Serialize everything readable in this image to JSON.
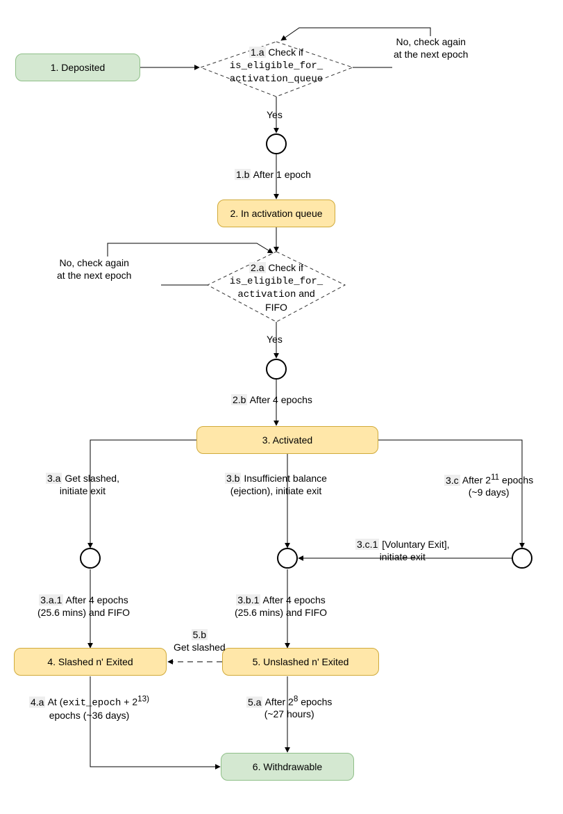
{
  "states": {
    "deposited": "1. Deposited",
    "in_queue": "2. In activation queue",
    "activated": "3. Activated",
    "slashed_exited": "4. Slashed n' Exited",
    "unslashed_exited": "5. Unslashed n' Exited",
    "withdrawable": "6. Withdrawable"
  },
  "steps": {
    "s1a": "1.a",
    "s1b": "1.b",
    "s2a": "2.a",
    "s2b": "2.b",
    "s3a": "3.a",
    "s3b": "3.b",
    "s3c": "3.c",
    "s3c1": "3.c.1",
    "s3a1": "3.a.1",
    "s3b1": "3.b.1",
    "s4a": "4.a",
    "s5a": "5.a",
    "s5b": "5.b"
  },
  "text": {
    "check_if": "Check if",
    "eligible_queue_code": "is_eligible_for_\nactivation_queue",
    "eligible_activation_code": "is_eligible_for_\nactivation",
    "and": " and",
    "fifo": "FIFO",
    "yes": "Yes",
    "no_check_again": "No, check again\nat the next epoch",
    "after_1_epoch": "After 1 epoch",
    "after_4_epochs": "After 4 epochs",
    "three_a_text": "Get slashed,\ninitiate exit",
    "three_b_text": "Insufficient balance\n(ejection), initiate exit",
    "three_c_text_1": "After 2",
    "three_c_exp": "11",
    "three_c_text_2": " epochs",
    "three_c_text_3": "(~9 days)",
    "three_c_1_text": "[Voluntary Exit],\ninitiate exit",
    "after_4_fifo": "After 4 epochs\n(25.6 mins) and FIFO",
    "four_a_at": "At (",
    "four_a_code": "exit_epoch",
    "four_a_plus": " + 2",
    "four_a_exp": "13)",
    "four_a_rest": "epochs (~36 days)",
    "five_a_1": "After 2",
    "five_a_exp": "8",
    "five_a_2": " epochs",
    "five_a_3": "(~27 hours)",
    "five_b": "Get slashed"
  }
}
